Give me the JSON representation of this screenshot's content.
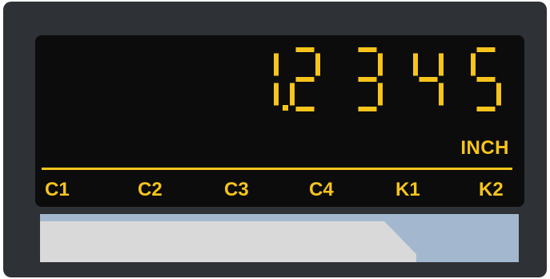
{
  "display": {
    "reading": "1.2345",
    "unit": "INCH",
    "channels": [
      "C1",
      "C2",
      "C3",
      "C4",
      "K1",
      "K2"
    ]
  },
  "colors": {
    "bezel": "#2e3135",
    "screen": "#0c0c0c",
    "segment_on": "#f7c41c",
    "label_light": "#d9d9d9",
    "label_accent": "#a3b8cf"
  }
}
